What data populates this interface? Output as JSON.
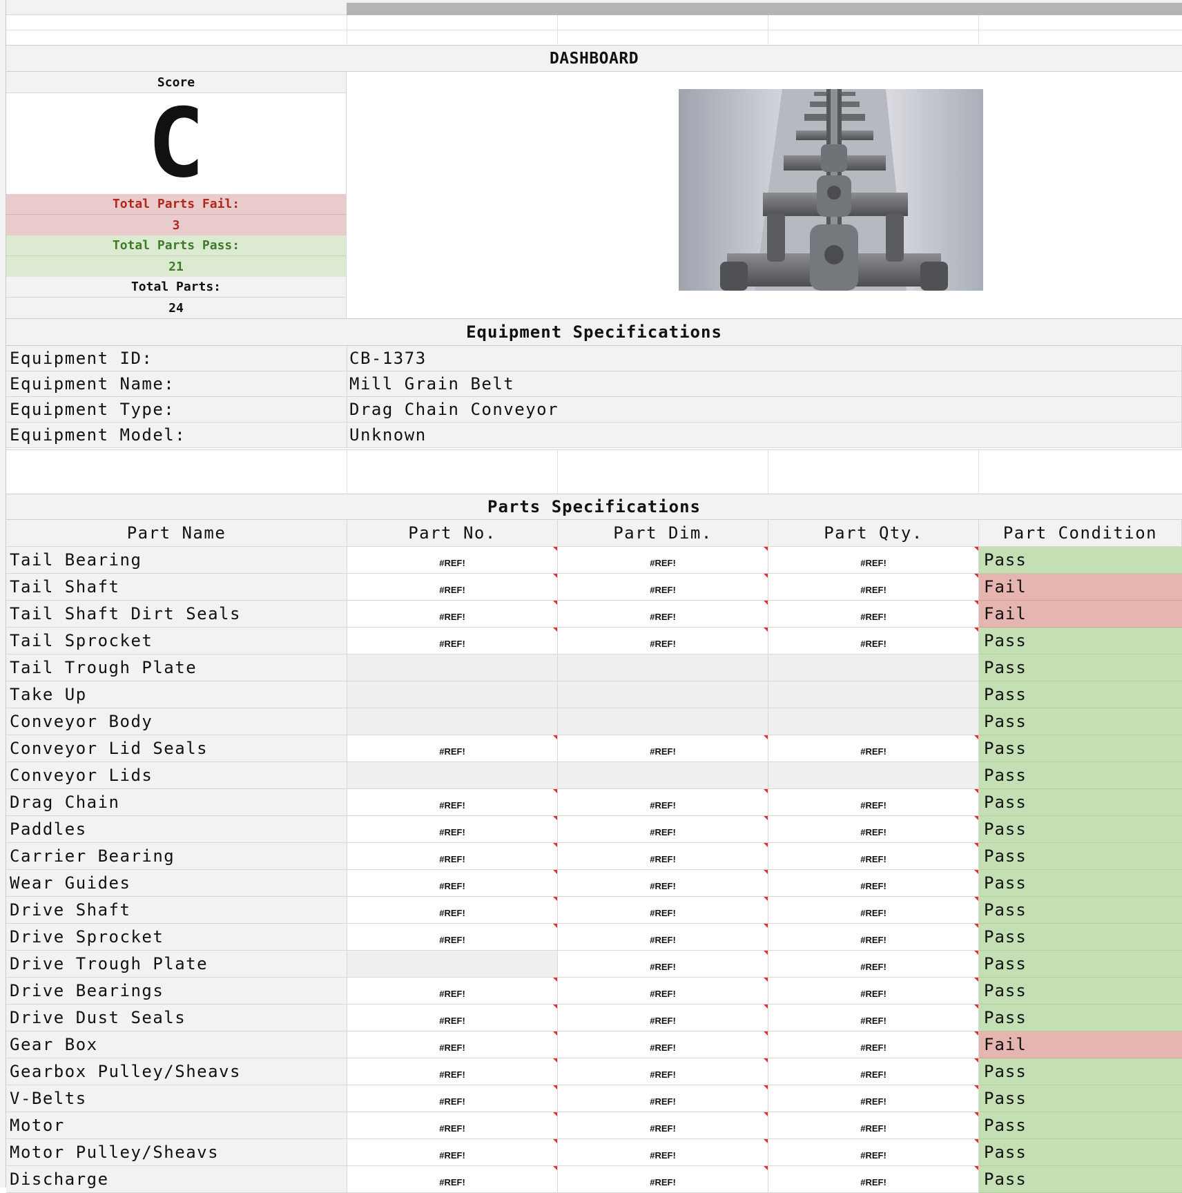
{
  "dashboard": {
    "title": "DASHBOARD"
  },
  "score": {
    "label": "Score",
    "grade": "C",
    "fail_label": "Total Parts Fail:",
    "fail_value": "3",
    "pass_label": "Total Parts Pass:",
    "pass_value": "21",
    "total_label": "Total Parts:",
    "total_value": "24"
  },
  "image": {
    "icon": "drag-chain-conveyor-photo"
  },
  "equipment": {
    "title": "Equipment Specifications",
    "rows": [
      {
        "label": "Equipment ID:",
        "value": "CB-1373"
      },
      {
        "label": "Equipment Name:",
        "value": "Mill Grain Belt"
      },
      {
        "label": "Equipment Type:",
        "value": "Drag Chain Conveyor"
      },
      {
        "label": "Equipment Model:",
        "value": "Unknown"
      }
    ]
  },
  "parts": {
    "title": "Parts Specifications",
    "headers": [
      "Part Name",
      "Part No.",
      "Part Dim.",
      "Part Qty.",
      "Part Condition"
    ],
    "rows": [
      {
        "name": "Tail Bearing",
        "no": "#REF!",
        "dim": "#REF!",
        "qty": "#REF!",
        "condition": "Pass"
      },
      {
        "name": "Tail Shaft",
        "no": "#REF!",
        "dim": "#REF!",
        "qty": "#REF!",
        "condition": "Fail"
      },
      {
        "name": "Tail Shaft Dirt Seals",
        "no": "#REF!",
        "dim": "#REF!",
        "qty": "#REF!",
        "condition": "Fail"
      },
      {
        "name": "Tail Sprocket",
        "no": "#REF!",
        "dim": "#REF!",
        "qty": "#REF!",
        "condition": "Pass"
      },
      {
        "name": "Tail Trough Plate",
        "no": "",
        "dim": "",
        "qty": "",
        "condition": "Pass"
      },
      {
        "name": "Take Up",
        "no": "",
        "dim": "",
        "qty": "",
        "condition": "Pass"
      },
      {
        "name": "Conveyor Body",
        "no": "",
        "dim": "",
        "qty": "",
        "condition": "Pass"
      },
      {
        "name": "Conveyor Lid Seals",
        "no": "#REF!",
        "dim": "#REF!",
        "qty": "#REF!",
        "condition": "Pass"
      },
      {
        "name": "Conveyor Lids",
        "no": "",
        "dim": "",
        "qty": "",
        "condition": "Pass"
      },
      {
        "name": "Drag Chain",
        "no": "#REF!",
        "dim": "#REF!",
        "qty": "#REF!",
        "condition": "Pass"
      },
      {
        "name": "Paddles",
        "no": "#REF!",
        "dim": "#REF!",
        "qty": "#REF!",
        "condition": "Pass"
      },
      {
        "name": "Carrier Bearing",
        "no": "#REF!",
        "dim": "#REF!",
        "qty": "#REF!",
        "condition": "Pass"
      },
      {
        "name": "Wear Guides",
        "no": "#REF!",
        "dim": "#REF!",
        "qty": "#REF!",
        "condition": "Pass"
      },
      {
        "name": "Drive Shaft",
        "no": "#REF!",
        "dim": "#REF!",
        "qty": "#REF!",
        "condition": "Pass"
      },
      {
        "name": "Drive Sprocket",
        "no": "#REF!",
        "dim": "#REF!",
        "qty": "#REF!",
        "condition": "Pass"
      },
      {
        "name": "Drive Trough Plate",
        "no": "",
        "dim": "#REF!",
        "qty": "#REF!",
        "condition": "Pass"
      },
      {
        "name": "Drive Bearings",
        "no": "#REF!",
        "dim": "#REF!",
        "qty": "#REF!",
        "condition": "Pass"
      },
      {
        "name": "Drive Dust Seals",
        "no": "#REF!",
        "dim": "#REF!",
        "qty": "#REF!",
        "condition": "Pass"
      },
      {
        "name": "Gear Box",
        "no": "#REF!",
        "dim": "#REF!",
        "qty": "#REF!",
        "condition": "Fail"
      },
      {
        "name": "Gearbox Pulley/Sheavs",
        "no": "#REF!",
        "dim": "#REF!",
        "qty": "#REF!",
        "condition": "Pass"
      },
      {
        "name": "V-Belts",
        "no": "#REF!",
        "dim": "#REF!",
        "qty": "#REF!",
        "condition": "Pass"
      },
      {
        "name": "Motor",
        "no": "#REF!",
        "dim": "#REF!",
        "qty": "#REF!",
        "condition": "Pass"
      },
      {
        "name": "Motor Pulley/Sheavs",
        "no": "#REF!",
        "dim": "#REF!",
        "qty": "#REF!",
        "condition": "Pass"
      },
      {
        "name": "Discharge",
        "no": "#REF!",
        "dim": "#REF!",
        "qty": "#REF!",
        "condition": "Pass"
      }
    ]
  },
  "colors": {
    "pass_bg": "#c5dfb4",
    "fail_bg": "#e6b5b0",
    "fail_text": "#b3261e",
    "pass_text": "#3d7a2a",
    "header_gray": "#f2f2f2"
  }
}
